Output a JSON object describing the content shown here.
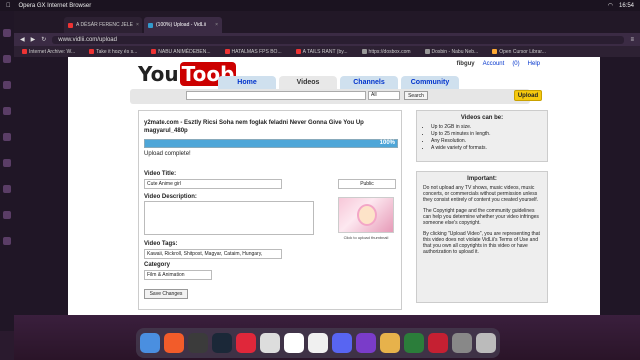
{
  "menubar": {
    "app": "Opera GX Internet Browser",
    "time": "16:54"
  },
  "tabs": [
    {
      "label": "A DÉSÁR FERENC JELE",
      "active": false
    },
    {
      "label": "(100%) Upload - VidLii",
      "active": true
    }
  ],
  "address": {
    "url": "www.vidlii.com/upload"
  },
  "bookmarks": [
    "Internet Archive: W...",
    "Take it hozy és s...",
    "NABU ANIMÉDEBEN...",
    "HATALMAS FPS BO...",
    "A TAILS RANT (by...",
    "https://dosbox.com",
    "Dosbin - Nabu Neb...",
    "Open Cursor Librar..."
  ],
  "site": {
    "logo_you": "You",
    "logo_toob": "Toob",
    "user": "fibguy",
    "account": "Account",
    "inbox": "(0)",
    "help": "Help",
    "nav": [
      "Home",
      "Videos",
      "Channels",
      "Community"
    ],
    "search_select": "All",
    "search_button": "Search",
    "upload_button": "Upload"
  },
  "upload": {
    "filename": "y2mate.com - Esztly Ricsi Soha nem foglak feladni Never Gonna Give You Up magyarul_480p",
    "progress_percent": 100,
    "progress_label": "100%",
    "status": "Upload complete!",
    "title_label": "Video Title:",
    "title_value": "Cute Anime girl",
    "privacy": "Public",
    "description_label": "Video Description:",
    "thumb_caption": "Click to upload thumbnail",
    "tags_label": "Video Tags:",
    "tags_value": "Kawaii, Rickroll, Shitpost, Magyar, Cataim, Hungary,",
    "category_label": "Category",
    "category_value": "Film & Animation",
    "save_button": "Save Changes"
  },
  "videos_box": {
    "title": "Videos can be:",
    "items": [
      "Up to 2GB in size.",
      "Up to 25 minutes in length.",
      "Any Resolution.",
      "A wide variety of formats."
    ]
  },
  "important_box": {
    "title": "Important:",
    "p1": "Do not upload any TV shows, music videos, music concerts, or commercials without permission unless they consist entirely of content you created yourself.",
    "p2": "The Copyright page and the community guidelines can help you determine whether your video infringes someone else's copyright.",
    "p3": "By clicking \"Upload Video\", you are representing that this video does not violate VidLii's Terms of Use and that you own all copyrights in this video or have authorization to upload it."
  }
}
